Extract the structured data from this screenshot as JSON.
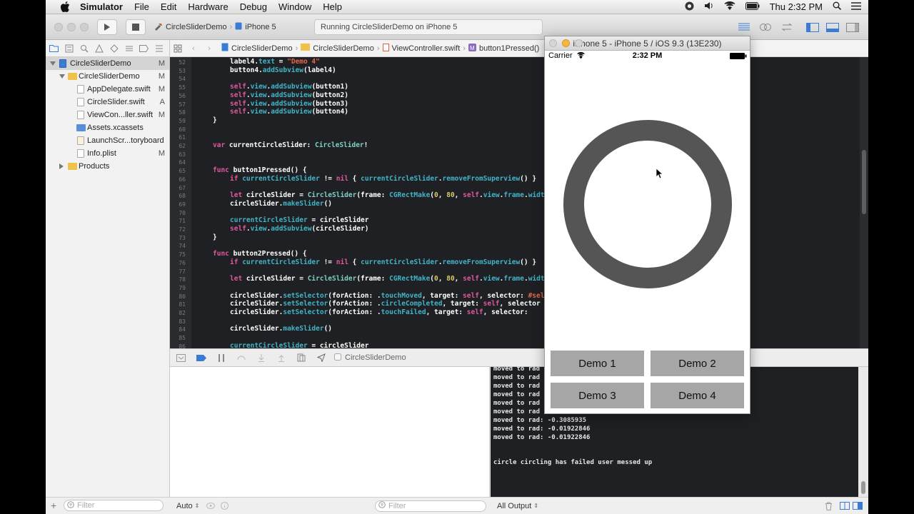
{
  "menubar": {
    "app": "Simulator",
    "items": [
      "File",
      "Edit",
      "Hardware",
      "Debug",
      "Window",
      "Help"
    ],
    "clock": "Thu 2:32 PM"
  },
  "toolbar": {
    "scheme": "CircleSliderDemo",
    "device": "iPhone 5",
    "activity": "Running CircleSliderDemo on iPhone 5"
  },
  "jumpbar": [
    "CircleSliderDemo",
    "CircleSliderDemo",
    "ViewController.swift",
    "button1Pressed()"
  ],
  "navigator": {
    "items": [
      {
        "label": "CircleSliderDemo",
        "status": "M"
      },
      {
        "label": "CircleSliderDemo",
        "status": "M"
      },
      {
        "label": "AppDelegate.swift",
        "status": "M"
      },
      {
        "label": "CircleSlider.swift",
        "status": "A"
      },
      {
        "label": "ViewCon...ller.swift",
        "status": "M"
      },
      {
        "label": "Assets.xcassets",
        "status": ""
      },
      {
        "label": "LaunchScr...toryboard",
        "status": ""
      },
      {
        "label": "Info.plist",
        "status": "M"
      },
      {
        "label": "Products",
        "status": ""
      }
    ],
    "filter_placeholder": "Filter"
  },
  "code_lines": [
    "52",
    "53",
    "54",
    "55",
    "56",
    "57",
    "58",
    "59",
    "60",
    "61",
    "62",
    "63",
    "64",
    "65",
    "66",
    "67",
    "68",
    "69",
    "70",
    "71",
    "72",
    "73",
    "74",
    "75",
    "76",
    "77",
    "78",
    "79",
    "80",
    "81",
    "82",
    "83",
    "84",
    "85",
    "86"
  ],
  "debugbar": {
    "target": "CircleSliderDemo"
  },
  "console": {
    "lines": [
      "moved to rad",
      "moved to rad",
      "moved to rad",
      "moved to rad",
      "moved to rad",
      "moved to rad",
      "moved to rad: -0.3085935",
      "moved to rad: -0.01922846",
      "moved to rad: -0.01922846",
      "circle circling has failed user messed up"
    ],
    "output_select": "All Output",
    "filter_placeholder": "Filter"
  },
  "variables": {
    "scope_select": "Auto"
  },
  "simulator": {
    "title": "iPhone 5 - iPhone 5 / iOS 9.3 (13E230)",
    "carrier": "Carrier",
    "time": "2:32 PM",
    "buttons": [
      "Demo 1",
      "Demo 2",
      "Demo 3",
      "Demo 4"
    ],
    "ring_color": "#555555"
  }
}
